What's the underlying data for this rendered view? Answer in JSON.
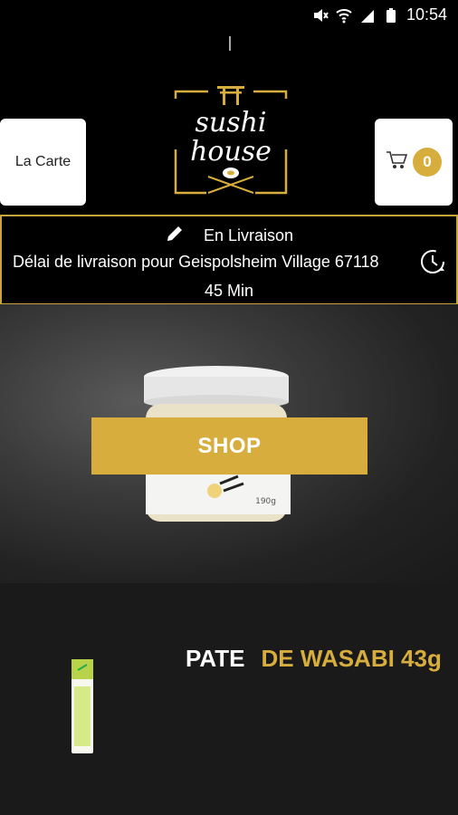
{
  "status_bar": {
    "time": "10:54"
  },
  "header": {
    "left_button_label": "La Carte",
    "cart_count": "0",
    "logo_text": {
      "line1": "sushi",
      "line2": "house"
    }
  },
  "delivery": {
    "mode": "En Livraison",
    "line": "Délai de livraison pour Geispolsheim Village 67118",
    "time": "45 Min"
  },
  "hero": {
    "jar_label_weight": "190g",
    "button_label": "SHOP"
  },
  "product": {
    "title_part1": "PATE",
    "title_part2": "DE WASABI 43g"
  },
  "colors": {
    "accent": "#d7ad3d",
    "background": "#000000",
    "panel": "#1a1a1a"
  }
}
